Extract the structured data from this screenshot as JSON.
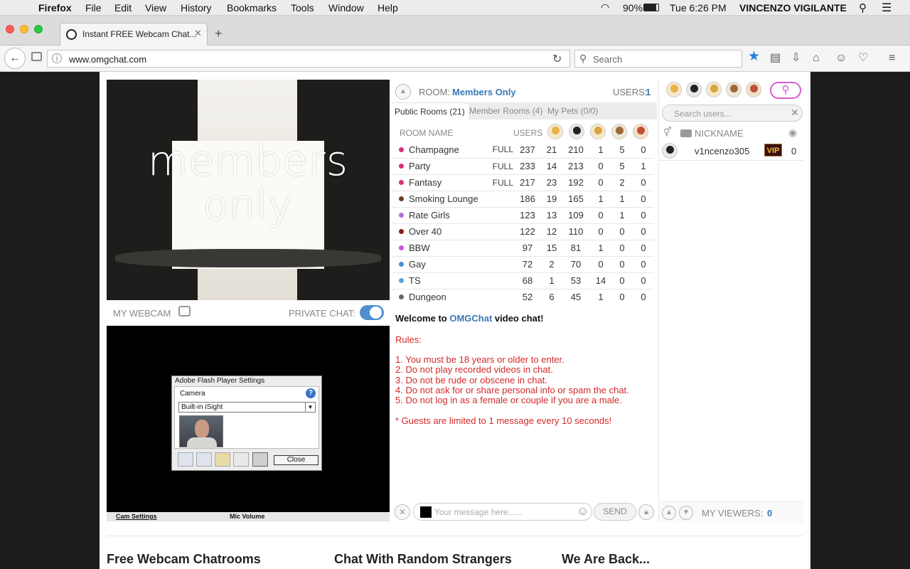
{
  "macos_menu": {
    "app": "Firefox",
    "items": [
      "File",
      "Edit",
      "View",
      "History",
      "Bookmarks",
      "Tools",
      "Window",
      "Help"
    ],
    "battery": "90%",
    "clock": "Tue 6:26 PM",
    "user": "VINCENZO VIGILANTE"
  },
  "browser": {
    "tab_title": "Instant FREE Webcam Chat...",
    "url": "www.omgchat.com",
    "search_placeholder": "Search"
  },
  "hero": {
    "line1": "members",
    "line2": "only"
  },
  "webcam": {
    "my_webcam_label": "MY WEBCAM",
    "private_chat_label": "PRIVATE CHAT:",
    "private_chat_on": true,
    "flash": {
      "title": "Adobe Flash Player Settings",
      "camera_label": "Camera",
      "camera_selected": "Built-in iSight",
      "close_label": "Close"
    },
    "bottom_bar": {
      "cam_settings": "Cam Settings",
      "mic_volume": "Mic Volume"
    }
  },
  "room": {
    "label": "ROOM:",
    "name": "Members Only",
    "users_label": "USERS:",
    "users_count": "1",
    "tabs": [
      "Public Rooms (21)",
      "Member Rooms (4)",
      "My Pets (0/0)"
    ],
    "col_room_name": "ROOM NAME",
    "col_users": "USERS",
    "rows": [
      {
        "name": "Champagne",
        "status": "FULL",
        "users": "237",
        "c1": "21",
        "c2": "210",
        "c3": "1",
        "c4": "5",
        "c5": "0",
        "color": "#d6307a"
      },
      {
        "name": "Party",
        "status": "FULL",
        "users": "233",
        "c1": "14",
        "c2": "213",
        "c3": "0",
        "c4": "5",
        "c5": "1",
        "color": "#d6307a"
      },
      {
        "name": "Fantasy",
        "status": "FULL",
        "users": "217",
        "c1": "23",
        "c2": "192",
        "c3": "0",
        "c4": "2",
        "c5": "0",
        "color": "#d6307a"
      },
      {
        "name": "Smoking Lounge",
        "status": "",
        "users": "186",
        "c1": "19",
        "c2": "165",
        "c3": "1",
        "c4": "1",
        "c5": "0",
        "color": "#6b3a1f"
      },
      {
        "name": "Rate Girls",
        "status": "",
        "users": "123",
        "c1": "13",
        "c2": "109",
        "c3": "0",
        "c4": "1",
        "c5": "0",
        "color": "#b26bd9"
      },
      {
        "name": "Over 40",
        "status": "",
        "users": "122",
        "c1": "12",
        "c2": "110",
        "c3": "0",
        "c4": "0",
        "c5": "0",
        "color": "#8a1a1a"
      },
      {
        "name": "BBW",
        "status": "",
        "users": "97",
        "c1": "15",
        "c2": "81",
        "c3": "1",
        "c4": "0",
        "c5": "0",
        "color": "#c45ad6"
      },
      {
        "name": "Gay",
        "status": "",
        "users": "72",
        "c1": "2",
        "c2": "70",
        "c3": "0",
        "c4": "0",
        "c5": "0",
        "color": "#4a8fd0"
      },
      {
        "name": "TS",
        "status": "",
        "users": "68",
        "c1": "1",
        "c2": "53",
        "c3": "14",
        "c4": "0",
        "c5": "0",
        "color": "#5ba8d8"
      },
      {
        "name": "Dungeon",
        "status": "",
        "users": "52",
        "c1": "6",
        "c2": "45",
        "c3": "1",
        "c4": "0",
        "c5": "0",
        "color": "#666666"
      }
    ]
  },
  "chat": {
    "welcome_prefix": "Welcome to ",
    "welcome_brand": "OMGChat",
    "welcome_suffix": " video chat!",
    "rules_title": "Rules:",
    "rules": [
      "1. You must be 18 years or older to enter.",
      "2. Do not play recorded videos in chat.",
      "3. Do not be rude or obscene in chat.",
      "4. Do not ask for or share personal info or spam the chat.",
      "5. Do not log in as a female or couple if you are a male."
    ],
    "guest_note": "* Guests are limited to 1 message every 10 seconds!",
    "input_placeholder": "Your message here......",
    "send_label": "SEND"
  },
  "users_panel": {
    "search_placeholder": "Search users...",
    "col_nickname": "NICKNAME",
    "users": [
      {
        "nickname": "v1ncenzo305",
        "badge": "VIP",
        "count": "0"
      }
    ],
    "my_viewers_label": "MY VIEWERS:",
    "my_viewers_count": "0"
  },
  "footer": {
    "headings": [
      "Free Webcam Chatrooms",
      "Chat With Random Strangers",
      "We Are Back..."
    ]
  },
  "colors": {
    "accent": "#3a78b6",
    "rules_red": "#d42a2a",
    "toggle": "#4f8fd0",
    "pink": "#d45bd6"
  }
}
